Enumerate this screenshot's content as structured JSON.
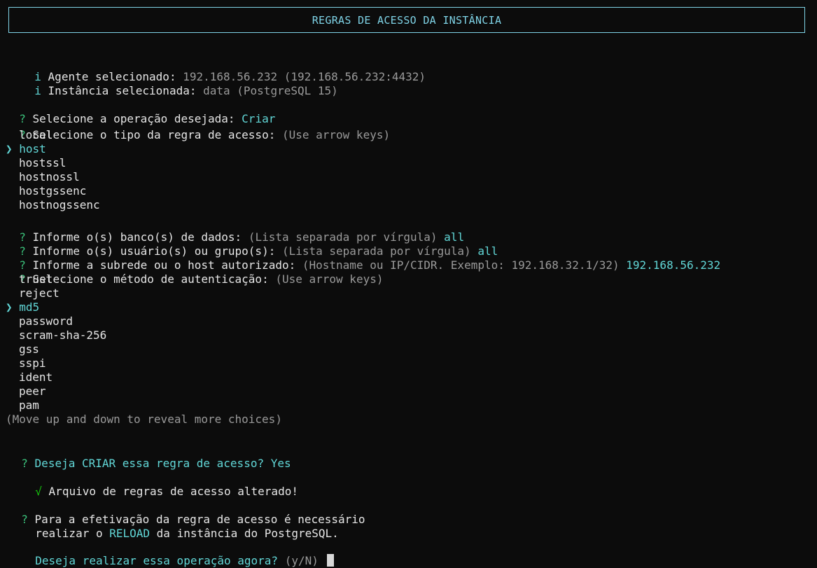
{
  "title": "REGRAS DE ACESSO DA INSTÂNCIA",
  "info": [
    {
      "icon": "i",
      "label": "Agente selecionado:",
      "value": "192.168.56.232 (192.168.56.232:4432)"
    },
    {
      "icon": "i",
      "label": "Instância selecionada:",
      "value": "data (PostgreSQL 15)"
    }
  ],
  "q_operation": {
    "mark": "?",
    "label": "Selecione a operação desejada:",
    "answer": "Criar"
  },
  "q_rule_type": {
    "mark": "?",
    "label": "Selecione o tipo da regra de acesso:",
    "hint": "(Use arrow keys)",
    "pointer": "❯",
    "options": [
      "local",
      "host",
      "hostssl",
      "hostnossl",
      "hostgssenc",
      "hostnogssenc"
    ],
    "selected": "host"
  },
  "q_databases": {
    "mark": "?",
    "label": "Informe o(s) banco(s) de dados:",
    "hint": "(Lista separada por vírgula)",
    "answer": "all"
  },
  "q_users": {
    "mark": "?",
    "label": "Informe o(s) usuário(s) ou grupo(s):",
    "hint": "(Lista separada por vírgula)",
    "answer": "all"
  },
  "q_subnet": {
    "mark": "?",
    "label": "Informe a subrede ou o host autorizado:",
    "hint": "(Hostname ou IP/CIDR. Exemplo: 192.168.32.1/32)",
    "answer": "192.168.56.232"
  },
  "q_auth": {
    "mark": "?",
    "label": "Selecione o método de autenticação:",
    "hint": "(Use arrow keys)",
    "pointer": "❯",
    "options": [
      "trust",
      "reject",
      "md5",
      "password",
      "scram-sha-256",
      "gss",
      "sspi",
      "ident",
      "peer",
      "pam"
    ],
    "selected": "md5",
    "more_hint": "(Move up and down to reveal more choices)"
  },
  "q_confirm": {
    "mark": "?",
    "label_pre": "Deseja",
    "label_em": "CRIAR",
    "label_post": "essa regra de acesso?",
    "answer": "Yes"
  },
  "success": {
    "mark": "√",
    "text": "Arquivo de regras de acesso alterado!"
  },
  "q_reload": {
    "mark": "?",
    "line1": "Para a efetivação da regra de acesso é necessário",
    "line2_pre": "realizar o",
    "line2_em": "RELOAD",
    "line2_post": "da instância do PostgreSQL."
  },
  "prompt": {
    "text": "Deseja realizar essa operação agora?",
    "hint": "(y/N)"
  }
}
